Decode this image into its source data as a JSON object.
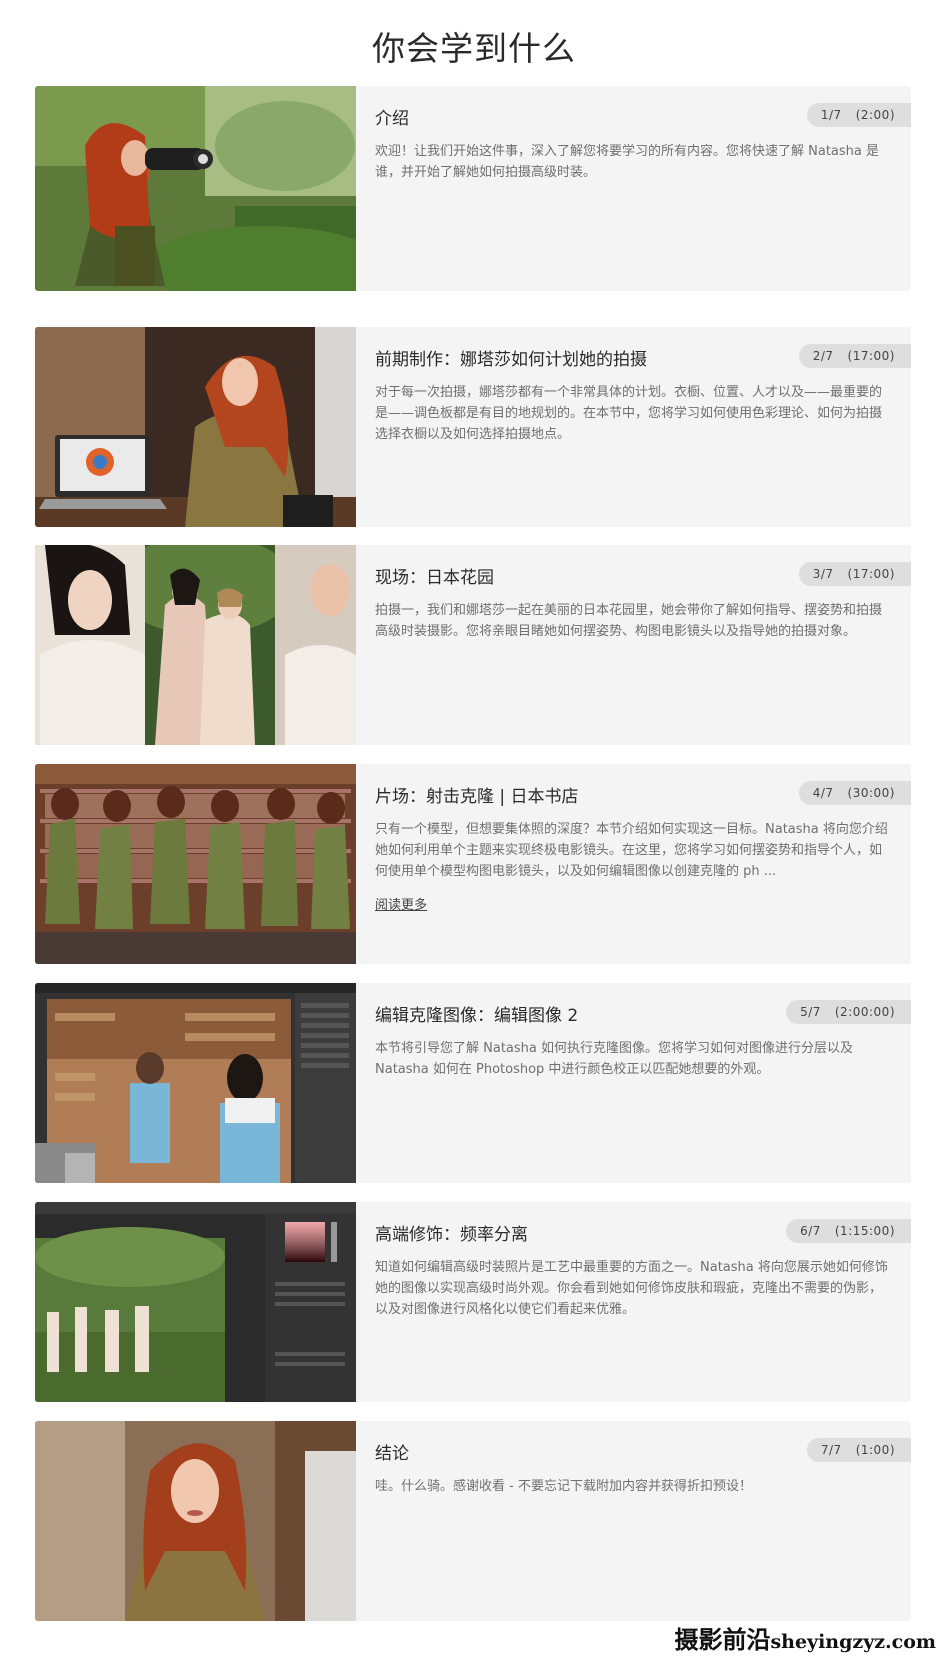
{
  "page": {
    "title": "你会学到什么"
  },
  "lessons": [
    {
      "title": "介绍",
      "index": "1/7",
      "duration": "(2:00)",
      "description": "欢迎！让我们开始这件事，深入了解您将要学习的所有内容。您将快速了解 Natasha 是谁，并开始了解她如何拍摄高级时装。",
      "thumbnail_icon": "photographer-in-garden-photo"
    },
    {
      "title": "前期制作：娜塔莎如何计划她的拍摄",
      "index": "2/7",
      "duration": "(17:00)",
      "description": "对于每一次拍摄，娜塔莎都有一个非常具体的计划。衣橱、位置、人才以及——最重要的是——调色板都是有目的地规划的。在本节中，您将学习如何使用色彩理论、如何为拍摄选择衣橱以及如何选择拍摄地点。",
      "thumbnail_icon": "woman-with-laptop-photo"
    },
    {
      "title": "现场：日本花园",
      "index": "3/7",
      "duration": "(17:00)",
      "description": "拍摄一，我们和娜塔莎一起在美丽的日本花园里，她会带你了解如何指导、摆姿势和拍摄高级时装摄影。您将亲眼目睹她如何摆姿势、构图电影镜头以及指导她的拍摄对象。",
      "thumbnail_icon": "models-in-garden-photo"
    },
    {
      "title": "片场：射击克隆 | 日本书店",
      "index": "4/7",
      "duration": "(30:00)",
      "description": "只有一个模型，但想要集体照的深度？本节介绍如何实现这一目标。Natasha 将向您介绍她如何利用单个主题来实现终极电影镜头。在这里，您将学习如何摆姿势和指导个人，如何使用单个模型构图电影镜头，以及如何编辑图像以创建克隆的 ph ...",
      "read_more": "阅读更多",
      "thumbnail_icon": "cloned-model-bookstore-photo"
    },
    {
      "title": "编辑克隆图像：编辑图像 2",
      "index": "5/7",
      "duration": "(2:00:00)",
      "description": "本节将引导您了解 Natasha 如何执行克隆图像。您将学习如何对图像进行分层以及 Natasha 如何在 Photoshop 中进行颜色校正以匹配她想要的外观。",
      "thumbnail_icon": "photoshop-bookstore-edit-screenshot"
    },
    {
      "title": "高端修饰：频率分离",
      "index": "6/7",
      "duration": "(1:15:00)",
      "description": "知道如何编辑高级时装照片是工艺中最重要的方面之一。Natasha 将向您展示她如何修饰她的图像以实现高级时尚外观。你会看到她如何修饰皮肤和瑕疵，克隆出不需要的伪影，以及对图像进行风格化以使它们看起来优雅。",
      "thumbnail_icon": "photoshop-garden-retouch-screenshot"
    },
    {
      "title": "结论",
      "index": "7/7",
      "duration": "(1:00)",
      "description": "哇。什么骑。感谢收看 - 不要忘记下载附加内容并获得折扣预设！",
      "thumbnail_icon": "woman-talking-to-camera-photo"
    }
  ],
  "watermark": {
    "cn": "摄影前沿",
    "en": "sheyingzyz.com"
  }
}
